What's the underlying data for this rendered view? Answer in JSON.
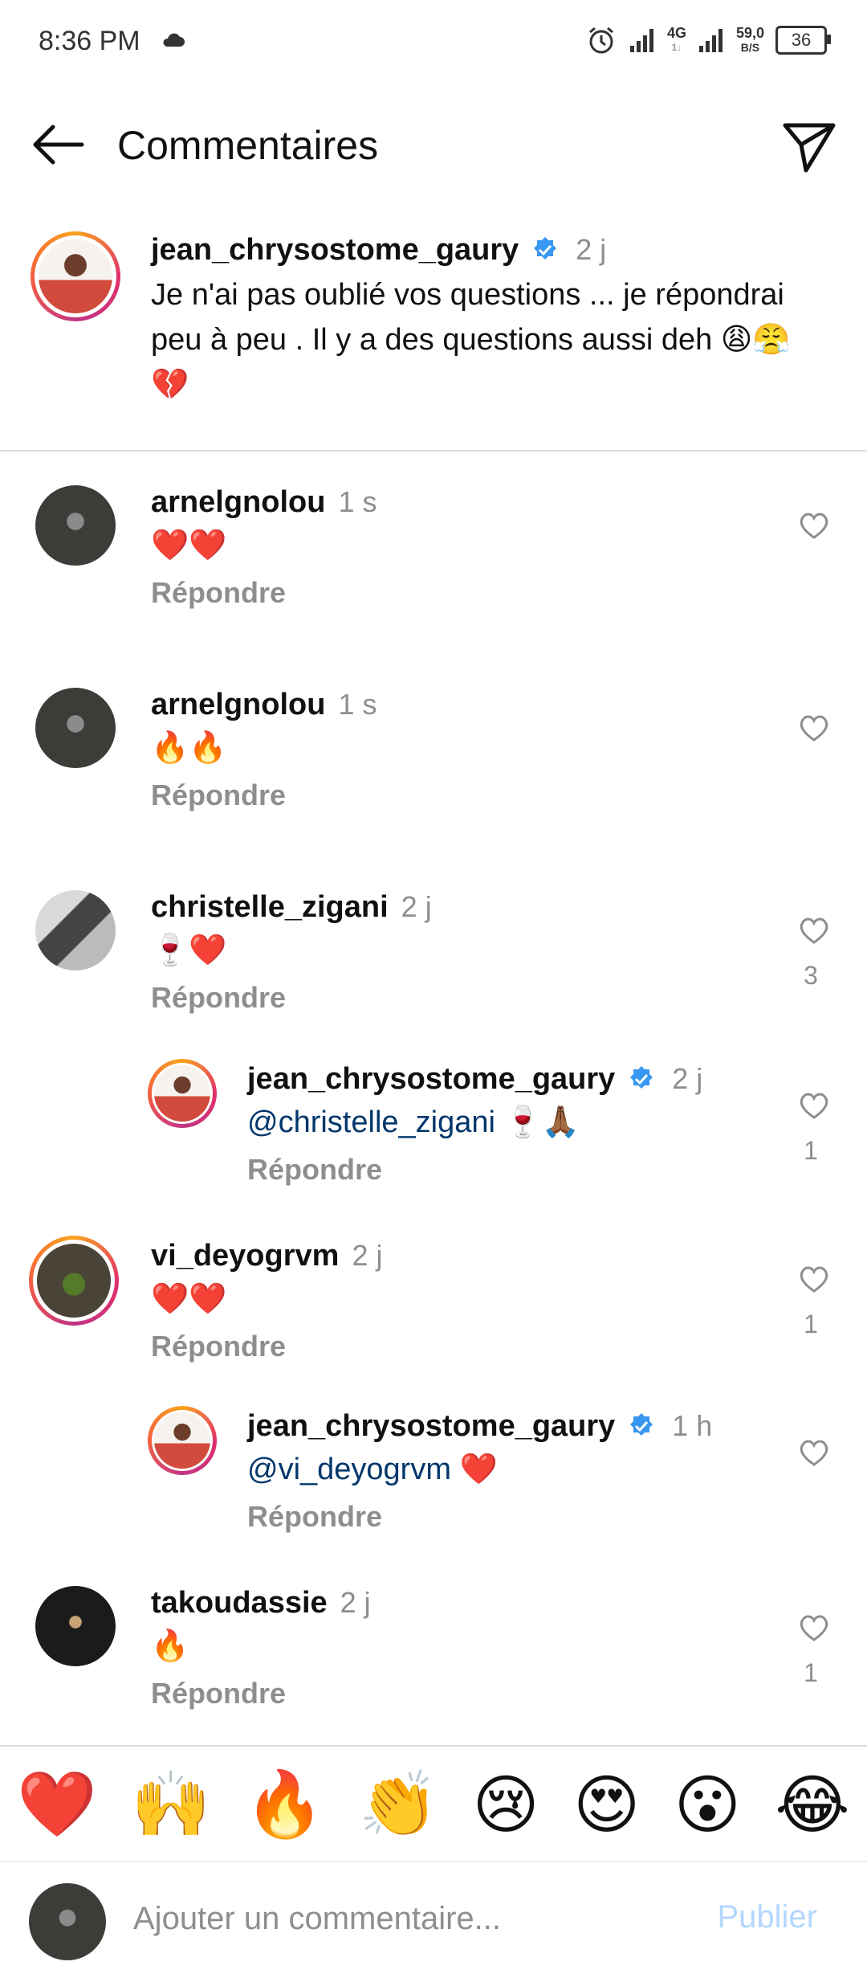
{
  "status_bar": {
    "time": "8:36 PM",
    "net_top": "4G",
    "net_bottom": "1↓",
    "speed_top": "59,0",
    "speed_bottom": "B/S",
    "battery": "36"
  },
  "header": {
    "title": "Commentaires"
  },
  "caption": {
    "username": "jean_chrysostome_gaury",
    "time": "2 j",
    "text": "Je n'ai pas oublié vos questions ... je répondrai peu à peu . Il y a des questions aussi deh 😩😤💔"
  },
  "comments": [
    {
      "username": "arnelgnolou",
      "time": "1 s",
      "text": "❤️❤️",
      "reply": "Répondre",
      "likes": ""
    },
    {
      "username": "arnelgnolou",
      "time": "1 s",
      "text": "🔥🔥",
      "reply": "Répondre",
      "likes": ""
    },
    {
      "username": "christelle_zigani",
      "time": "2 j",
      "text": "🍷❤️",
      "reply": "Répondre",
      "likes": "3"
    },
    {
      "username": "jean_chrysostome_gaury",
      "time": "2 j",
      "mention": "@christelle_zigani",
      "text": " 🍷🙏🏾",
      "reply": "Répondre",
      "likes": "1"
    },
    {
      "username": "vi_deyogrvm",
      "time": "2 j",
      "text": "❤️❤️",
      "reply": "Répondre",
      "likes": "1"
    },
    {
      "username": "jean_chrysostome_gaury",
      "time": "1 h",
      "mention": "@vi_deyogrvm",
      "text": " ❤️",
      "reply": "Répondre",
      "likes": ""
    },
    {
      "username": "takoudassie",
      "time": "2 j",
      "text": "🔥",
      "reply": "Répondre",
      "likes": "1"
    }
  ],
  "emoji_bar": [
    "❤️",
    "🙌",
    "🔥",
    "👏",
    "😢",
    "😍",
    "😮",
    "😂"
  ],
  "composer": {
    "placeholder": "Ajouter un commentaire...",
    "publish": "Publier"
  },
  "colors": {
    "accent_link": "#00376b",
    "verified": "#3897f0",
    "publish_disabled": "#b3d7ff",
    "muted": "#8e8e8e"
  }
}
